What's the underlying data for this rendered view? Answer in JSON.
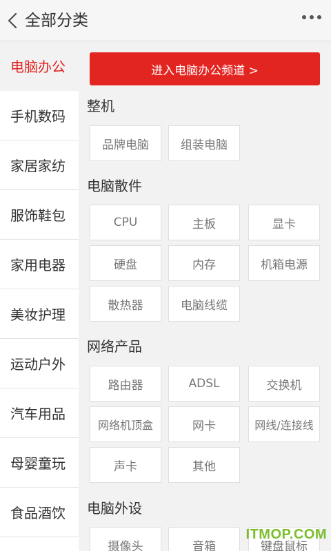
{
  "header": {
    "title": "全部分类",
    "back_icon": "chevron-left-icon",
    "more_icon": "more-dots-icon"
  },
  "sidebar": {
    "active_color": "#e02320",
    "items": [
      {
        "label": "电脑办公",
        "active": true
      },
      {
        "label": "手机数码"
      },
      {
        "label": "家居家纺"
      },
      {
        "label": "服饰鞋包"
      },
      {
        "label": "家用电器"
      },
      {
        "label": "美妆护理"
      },
      {
        "label": "运动户外"
      },
      {
        "label": "汽车用品"
      },
      {
        "label": "母婴童玩"
      },
      {
        "label": "食品酒饮"
      }
    ]
  },
  "main": {
    "channel_button": "进入电脑办公频道 >",
    "channel_color": "#e32521",
    "sections": [
      {
        "title": "整机",
        "tags": [
          "品牌电脑",
          "组装电脑"
        ]
      },
      {
        "title": "电脑散件",
        "tags": [
          "CPU",
          "主板",
          "显卡",
          "硬盘",
          "内存",
          "机箱电源",
          "散热器",
          "电脑线缆"
        ]
      },
      {
        "title": "网络产品",
        "tags": [
          "路由器",
          "ADSL",
          "交换机",
          "网络机顶盒",
          "网卡",
          "网线/连接线",
          "声卡",
          "其他"
        ]
      },
      {
        "title": "电脑外设",
        "tags": [
          "摄像头",
          "音箱",
          "键盘鼠标"
        ]
      }
    ]
  },
  "watermark": "ITMOP.COM"
}
